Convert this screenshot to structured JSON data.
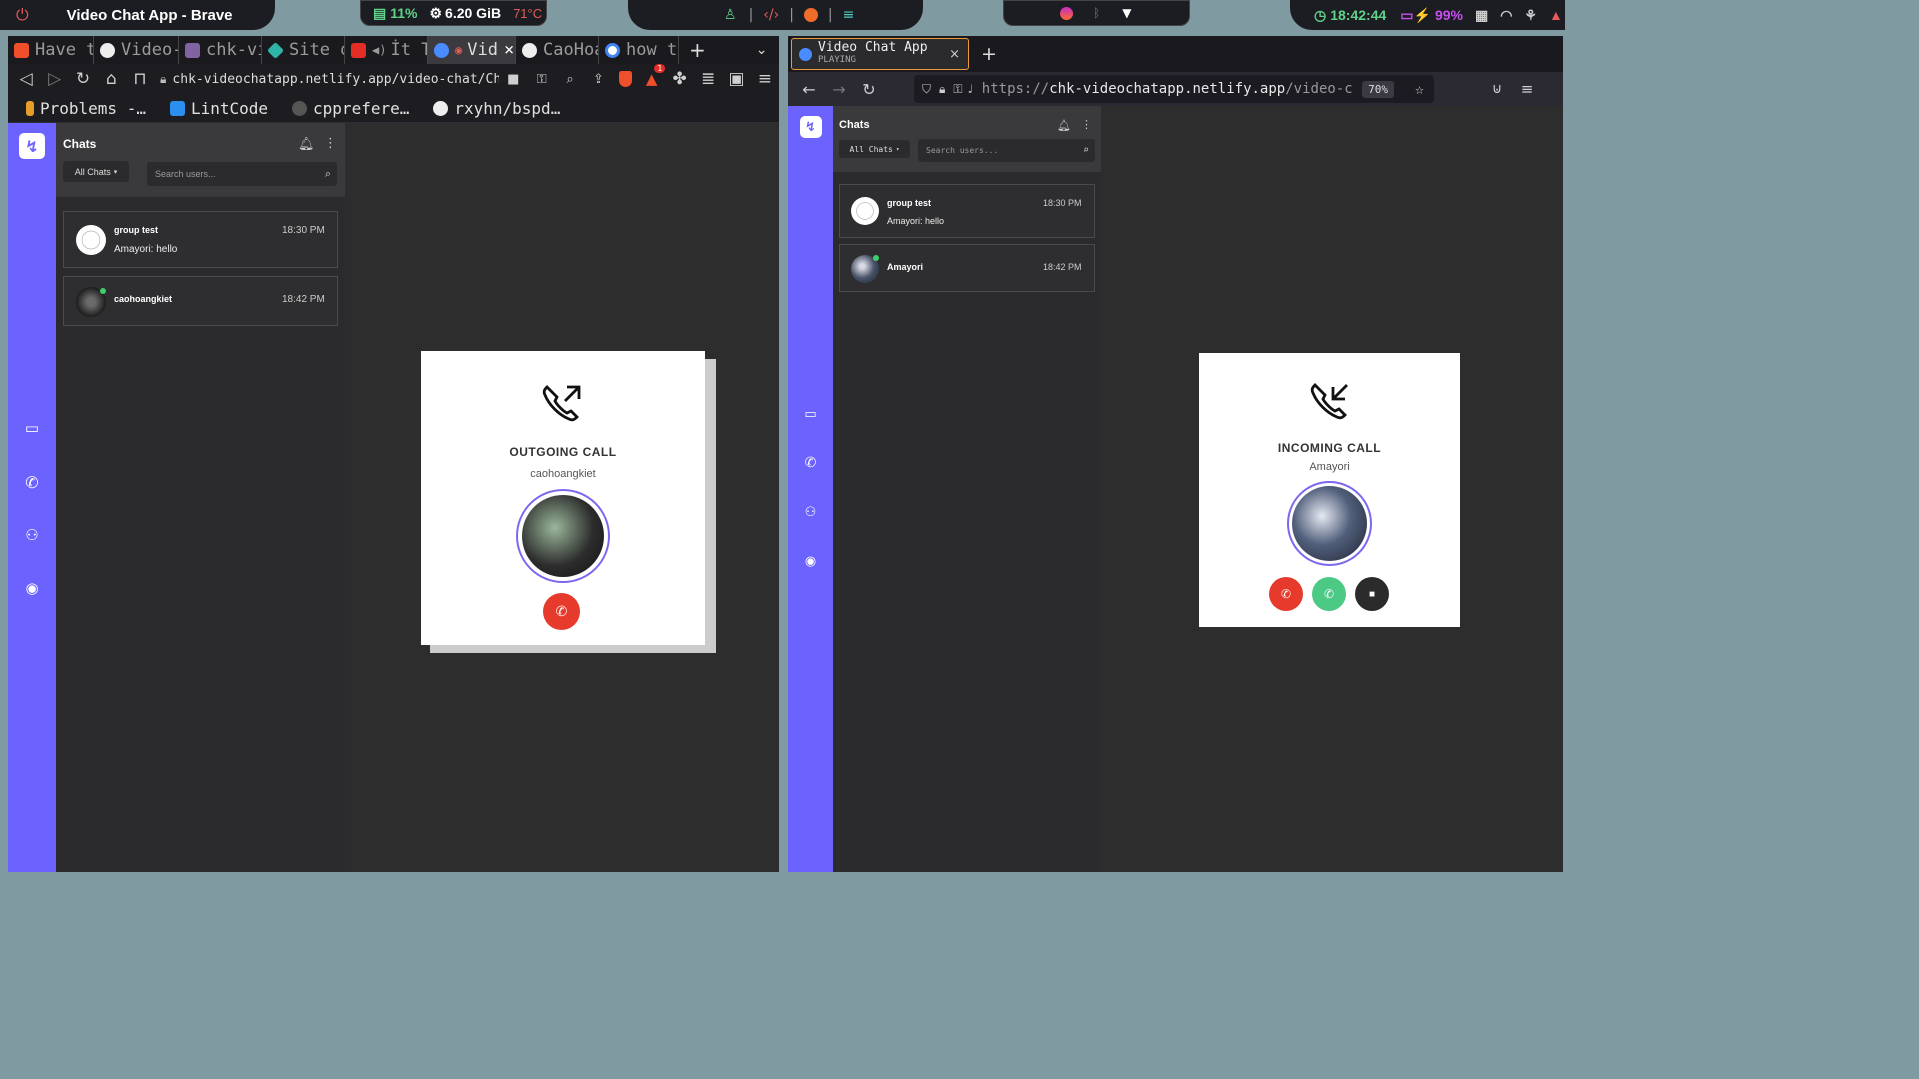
{
  "topbar": {
    "window_title": "Video Chat App - Brave",
    "cpu": "11%",
    "mem": "6.20 GiB",
    "temp": "71°C",
    "clock": "18:42:44",
    "battery": "99%"
  },
  "left_browser": {
    "tabs": [
      "Have t",
      "Video-",
      "chk-vi",
      "Site o",
      "İt T",
      "Vid",
      "CaoHoa",
      "how to"
    ],
    "url": "chk-videochatapp.netlify.app/video-chat/Chats/meeti…",
    "bookmarks": [
      "Problems -…",
      "LintCode",
      "cpprefere…",
      "rxyhn/bspd…"
    ],
    "badge": "1"
  },
  "right_browser": {
    "tab_title": "Video Chat App",
    "tab_sub": "PLAYING",
    "url_scheme": "https://",
    "url_host": "chk-videochatapp.netlify.app",
    "url_path": "/video-c",
    "zoom": "70%"
  },
  "left_app": {
    "chats_title": "Chats",
    "filter": "All Chats",
    "search_placeholder": "Search users...",
    "items": [
      {
        "name": "group test",
        "time": "18:30 PM",
        "message": "Amayori: hello"
      },
      {
        "name": "caohoangkiet",
        "time": "18:42 PM",
        "message": ""
      }
    ],
    "call": {
      "title": "OUTGOING CALL",
      "name": "caohoangkiet"
    }
  },
  "right_app": {
    "chats_title": "Chats",
    "filter": "All Chats",
    "search_placeholder": "Search users...",
    "items": [
      {
        "name": "group test",
        "time": "18:30 PM",
        "message": "Amayori: hello"
      },
      {
        "name": "Amayori",
        "time": "18:42 PM",
        "message": ""
      }
    ],
    "call": {
      "title": "INCOMING CALL",
      "name": "Amayori"
    }
  },
  "colors": {
    "accent": "#6c63ff",
    "decline": "#e53a2c",
    "accept": "#4cc985",
    "video": "#2b2b2b"
  }
}
